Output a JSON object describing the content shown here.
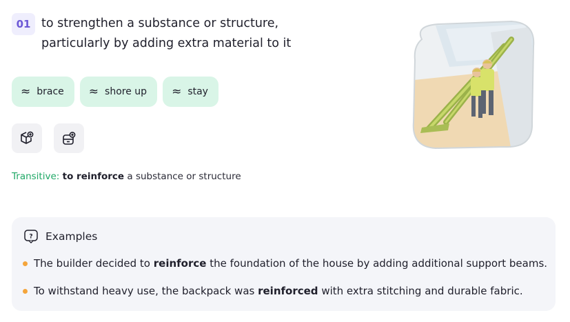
{
  "sense": {
    "number": "01",
    "definition": "to strengthen a substance or structure, particularly by adding extra material to it"
  },
  "synonyms": [
    {
      "label": "brace"
    },
    {
      "label": "shore up"
    },
    {
      "label": "stay"
    }
  ],
  "actions": [
    {
      "icon": "cube-plus-icon"
    },
    {
      "icon": "card-add-icon"
    }
  ],
  "usage": {
    "label": "Transitive:",
    "phrase": "to reinforce",
    "rest": "a substance or structure"
  },
  "examples": {
    "title": "Examples",
    "items": [
      {
        "before": "The builder decided to",
        "keyword": "reinforce",
        "after": "the foundation of the house by adding additional support beams."
      },
      {
        "before": "To withstand heavy use, the backpack was",
        "keyword": "reinforced",
        "after": "with extra stitching and durable fabric."
      }
    ]
  },
  "colors": {
    "badge_bg": "#efeefd",
    "badge_text": "#6d59d6",
    "chip_bg": "#d9f5e7",
    "usage_label": "#1fa866",
    "bullet": "#f4a53c",
    "examples_bg": "#f4f5f9"
  }
}
